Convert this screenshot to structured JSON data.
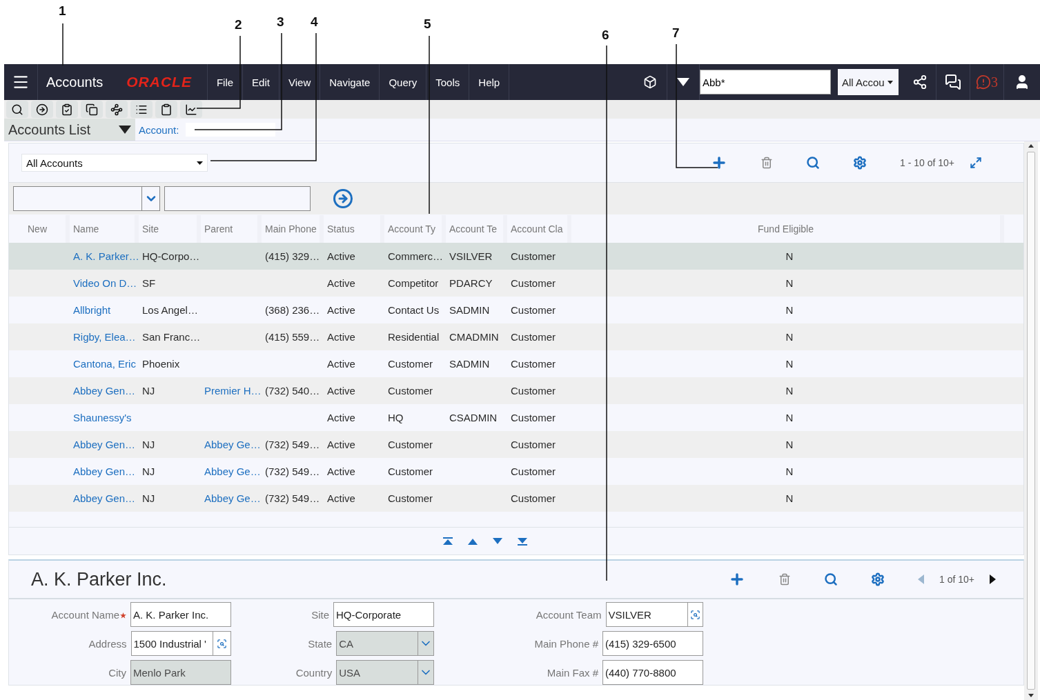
{
  "callouts": [
    {
      "label": "1"
    },
    {
      "label": "2"
    },
    {
      "label": "3"
    },
    {
      "label": "4"
    },
    {
      "label": "5"
    },
    {
      "label": "6"
    },
    {
      "label": "7"
    }
  ],
  "header": {
    "title": "Accounts",
    "logo": "ORACLE",
    "menu": [
      "File",
      "Edit",
      "View",
      "Navigate",
      "Query",
      "Tools",
      "Help"
    ],
    "search": {
      "value": "Abb*"
    },
    "scope": "All Accou",
    "notifications": "3"
  },
  "view": {
    "title": "Accounts List",
    "link": "Account:"
  },
  "list": {
    "filter": "All Accounts",
    "pager": "1 - 10 of 10+",
    "columns": [
      "New",
      "Name",
      "Site",
      "Parent",
      "Main Phone",
      "Status",
      "Account Ty",
      "Account Te",
      "Account Cla",
      "Fund Eligible"
    ],
    "rows": [
      {
        "selected": true,
        "cells": [
          "",
          "A. K. Parker…",
          "HQ-Corpo…",
          "",
          "(415) 329…",
          "Active",
          "Commerc…",
          "VSILVER",
          "Customer",
          "N"
        ]
      },
      {
        "selected": false,
        "cells": [
          "",
          "Video On D…",
          "SF",
          "",
          "",
          "Active",
          "Competitor",
          "PDARCY",
          "Customer",
          "N"
        ]
      },
      {
        "selected": false,
        "cells": [
          "",
          "Allbright",
          "Los Angel…",
          "",
          "(368) 236…",
          "Active",
          "Contact Us",
          "SADMIN",
          "Customer",
          "N"
        ]
      },
      {
        "selected": false,
        "cells": [
          "",
          "Rigby, Elea…",
          "San Franc…",
          "",
          "(415) 559…",
          "Active",
          "Residential",
          "CMADMIN",
          "Customer",
          "N"
        ]
      },
      {
        "selected": false,
        "cells": [
          "",
          "Cantona, Eric",
          "Phoenix",
          "",
          "",
          "Active",
          "Customer",
          "SADMIN",
          "Customer",
          "N"
        ]
      },
      {
        "selected": false,
        "cells": [
          "",
          "Abbey Gen…",
          "NJ",
          "Premier H…",
          "(732) 540…",
          "Active",
          "Customer",
          "",
          "Customer",
          "N"
        ]
      },
      {
        "selected": false,
        "cells": [
          "",
          "Shaunessy's",
          "",
          "",
          "",
          "Active",
          "HQ",
          "CSADMIN",
          "Customer",
          "N"
        ]
      },
      {
        "selected": false,
        "cells": [
          "",
          "Abbey Gen…",
          "NJ",
          "Abbey Ge…",
          "(732) 549…",
          "Active",
          "Customer",
          "",
          "Customer",
          "N"
        ]
      },
      {
        "selected": false,
        "cells": [
          "",
          "Abbey Gen…",
          "NJ",
          "Abbey Ge…",
          "(732) 549…",
          "Active",
          "Customer",
          "",
          "Customer",
          "N"
        ]
      },
      {
        "selected": false,
        "cells": [
          "",
          "Abbey Gen…",
          "NJ",
          "Abbey Ge…",
          "(732) 549…",
          "Active",
          "Customer",
          "",
          "Customer",
          "N"
        ]
      }
    ]
  },
  "form": {
    "title": "A. K. Parker Inc.",
    "pager": "1 of 10+",
    "columns": [
      [
        {
          "label": "Account Name",
          "value": "A. K. Parker Inc.",
          "kind": "text",
          "readonly": false,
          "required": true
        },
        {
          "label": "Address",
          "value": "1500 Industrial '",
          "kind": "pick",
          "readonly": false,
          "required": false
        },
        {
          "label": "City",
          "value": "Menlo Park",
          "kind": "text",
          "readonly": true,
          "required": false
        }
      ],
      [
        {
          "label": "Site",
          "value": "HQ-Corporate",
          "kind": "text",
          "readonly": false,
          "required": false
        },
        {
          "label": "State",
          "value": "CA",
          "kind": "select",
          "readonly": true,
          "required": false
        },
        {
          "label": "Country",
          "value": "USA",
          "kind": "select",
          "readonly": true,
          "required": false
        }
      ],
      [
        {
          "label": "Account Team",
          "value": "VSILVER",
          "kind": "pick",
          "readonly": false,
          "required": false
        },
        {
          "label": "Main Phone #",
          "value": "(415) 329-6500",
          "kind": "text",
          "readonly": false,
          "required": false
        },
        {
          "label": "Main Fax #",
          "value": "(440) 770-8800",
          "kind": "text",
          "readonly": false,
          "required": false
        }
      ]
    ]
  }
}
